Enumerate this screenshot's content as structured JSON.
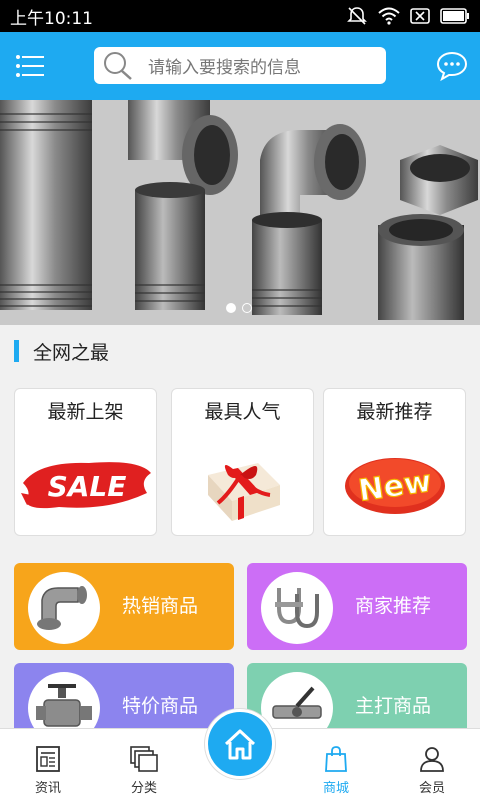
{
  "status_bar": {
    "time": "上午10:11"
  },
  "search": {
    "placeholder": "请输入要搜索的信息"
  },
  "banner": {
    "slide_count": 2,
    "active_slide": 1
  },
  "section": {
    "title": "全网之最"
  },
  "cards": [
    {
      "label": "最新上架",
      "badge_text": "SALE",
      "icon": "sale-badge-icon"
    },
    {
      "label": "最具人气",
      "icon": "gift-box-icon"
    },
    {
      "label": "最新推荐",
      "badge_text": "New",
      "icon": "new-badge-icon"
    }
  ],
  "tiles": [
    {
      "label": "热销商品",
      "color": "#f7a51b",
      "icon": "pipe-elbow-icon"
    },
    {
      "label": "商家推荐",
      "color": "#cc6ef6",
      "icon": "u-bolt-icon"
    },
    {
      "label": "特价商品",
      "color": "#8c84ee",
      "icon": "ball-valve-icon"
    },
    {
      "label": "主打商品",
      "color": "#7ed0b0",
      "icon": "valve-handle-icon"
    }
  ],
  "tabbar": {
    "tabs": [
      {
        "label": "资讯",
        "icon": "news-icon"
      },
      {
        "label": "分类",
        "icon": "category-icon"
      },
      {
        "label": "商城",
        "icon": "shopping-bag-icon",
        "active": true
      },
      {
        "label": "会员",
        "icon": "user-icon"
      }
    ],
    "home_icon": "home-icon"
  },
  "colors": {
    "primary": "#1eaaf1"
  }
}
